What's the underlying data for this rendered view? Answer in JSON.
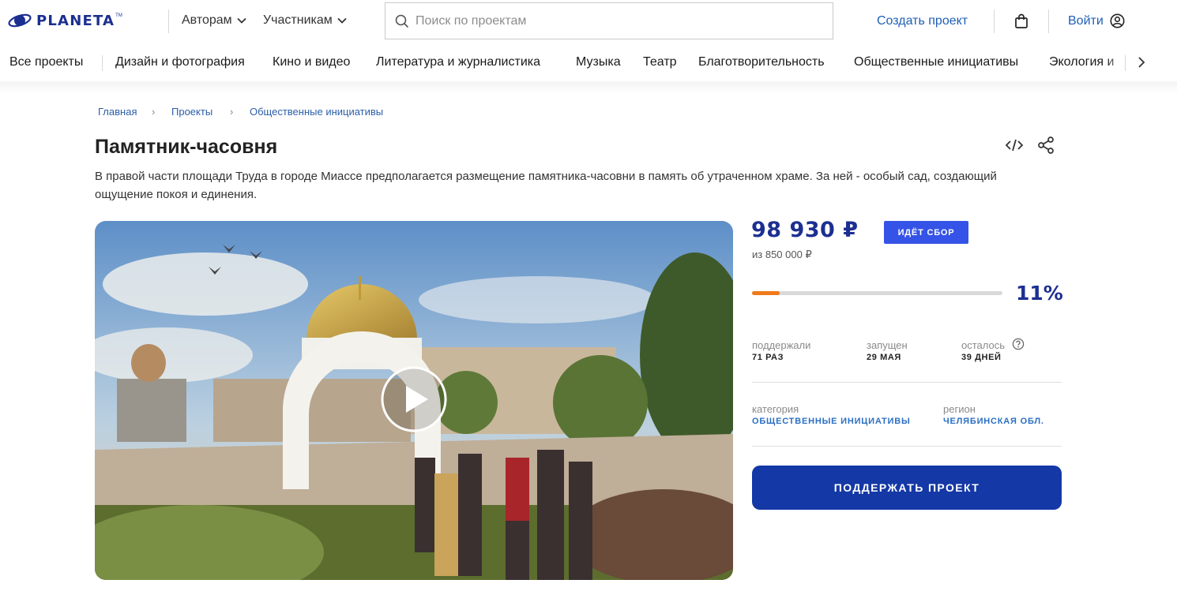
{
  "header": {
    "logo_text": "PLANETA",
    "logo_tm": "TM",
    "nav": [
      {
        "label": "Авторам",
        "icon": "chevron-down-icon"
      },
      {
        "label": "Участникам",
        "icon": "chevron-down-icon"
      }
    ],
    "search_placeholder": "Поиск по проектам",
    "create_project": "Создать проект",
    "cart_icon": "shopping-bag-icon",
    "login": "Войти",
    "user_icon": "user-circle-icon"
  },
  "categories": [
    "Все проекты",
    "Дизайн и фотография",
    "Кино и видео",
    "Литература и журналистика",
    "Музыка",
    "Театр",
    "Благотворительность",
    "Общественные инициативы",
    "Экология и"
  ],
  "breadcrumb": [
    "Главная",
    "Проекты",
    "Общественные инициативы"
  ],
  "project": {
    "title": "Памятник-часовня",
    "description": "В правой части площади Труда в городе Миассе предполагается размещение памятника-часовни в память об утраченном храме. За ней - особый сад, создающий ощущение покоя и единения.",
    "raised": "98 930 ₽",
    "status": "ИДЁТ СБОР",
    "goal": "из 850 000 ₽",
    "progress_percent": 11,
    "percent_label": "11%",
    "stats": {
      "backers_label": "поддержали",
      "backers_value": "71 РАЗ",
      "launched_label": "запущен",
      "launched_value": "29 МАЯ",
      "remaining_label": "осталось",
      "remaining_value": "39 ДНЕЙ"
    },
    "category_label": "категория",
    "category_value": "ОБЩЕСТВЕННЫЕ ИНИЦИАТИВЫ",
    "region_label": "регион",
    "region_value": "ЧЕЛЯБИНСКАЯ ОБЛ.",
    "support_button": "ПОДДЕРЖАТЬ ПРОЕКТ"
  },
  "colors": {
    "brand": "#1c2f91",
    "link": "#1e5fb5",
    "badge": "#3553e6",
    "progress": "#f07a1a",
    "button": "#1438a6"
  }
}
